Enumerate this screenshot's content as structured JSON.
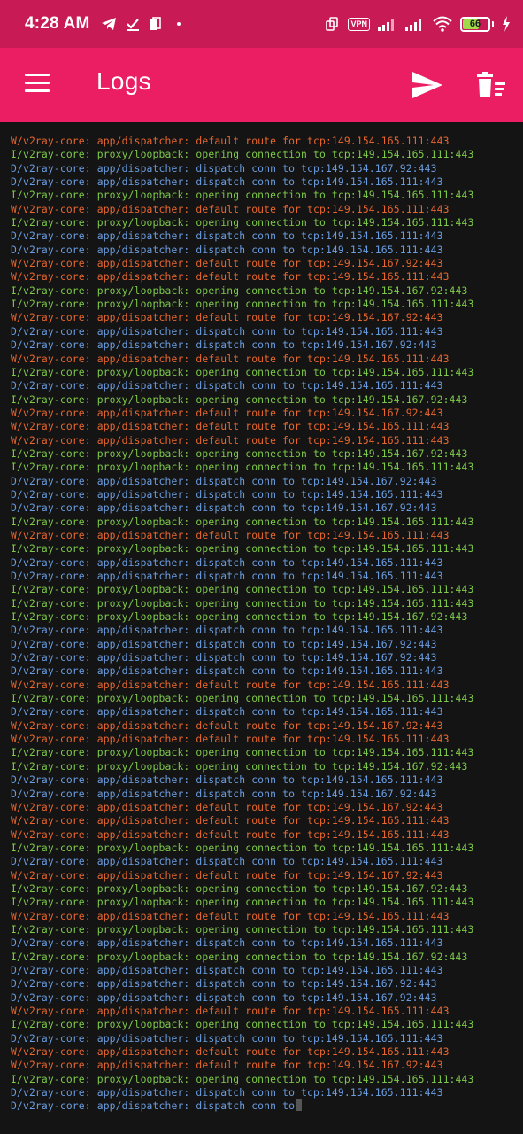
{
  "status_bar": {
    "time": "4:28 AM",
    "vpn_label": "VPN",
    "battery_level": "66",
    "icons": [
      "telegram-icon",
      "task-check-icon",
      "sim-card-icon",
      "dot-icon",
      "screen-rotate-icon",
      "vpn-icon",
      "signal-icon",
      "signal-icon",
      "wifi-icon",
      "battery-icon",
      "charging-icon"
    ]
  },
  "app_bar": {
    "title": "Logs",
    "color": "#eb1e64",
    "status_color": "#c81a55",
    "actions": [
      "menu-icon",
      "send-icon",
      "clear-all-icon"
    ]
  },
  "colors": {
    "W": "#e8672f",
    "I": "#7ec94a",
    "D": "#6a9de0",
    "background": "#141414"
  },
  "logs": [
    {
      "level": "W",
      "text": "W/v2ray-core: app/dispatcher: default route for tcp:149.154.165.111:443"
    },
    {
      "level": "I",
      "text": "I/v2ray-core: proxy/loopback: opening connection to tcp:149.154.165.111:443"
    },
    {
      "level": "D",
      "text": "D/v2ray-core: app/dispatcher: dispatch conn to tcp:149.154.167.92:443"
    },
    {
      "level": "D",
      "text": "D/v2ray-core: app/dispatcher: dispatch conn to tcp:149.154.165.111:443"
    },
    {
      "level": "I",
      "text": "I/v2ray-core: proxy/loopback: opening connection to tcp:149.154.165.111:443"
    },
    {
      "level": "W",
      "text": "W/v2ray-core: app/dispatcher: default route for tcp:149.154.165.111:443"
    },
    {
      "level": "I",
      "text": "I/v2ray-core: proxy/loopback: opening connection to tcp:149.154.165.111:443"
    },
    {
      "level": "D",
      "text": "D/v2ray-core: app/dispatcher: dispatch conn to tcp:149.154.165.111:443"
    },
    {
      "level": "D",
      "text": "D/v2ray-core: app/dispatcher: dispatch conn to tcp:149.154.165.111:443"
    },
    {
      "level": "W",
      "text": "W/v2ray-core: app/dispatcher: default route for tcp:149.154.167.92:443"
    },
    {
      "level": "W",
      "text": "W/v2ray-core: app/dispatcher: default route for tcp:149.154.165.111:443"
    },
    {
      "level": "I",
      "text": "I/v2ray-core: proxy/loopback: opening connection to tcp:149.154.167.92:443"
    },
    {
      "level": "I",
      "text": "I/v2ray-core: proxy/loopback: opening connection to tcp:149.154.165.111:443"
    },
    {
      "level": "W",
      "text": "W/v2ray-core: app/dispatcher: default route for tcp:149.154.167.92:443"
    },
    {
      "level": "D",
      "text": "D/v2ray-core: app/dispatcher: dispatch conn to tcp:149.154.165.111:443"
    },
    {
      "level": "D",
      "text": "D/v2ray-core: app/dispatcher: dispatch conn to tcp:149.154.167.92:443"
    },
    {
      "level": "W",
      "text": "W/v2ray-core: app/dispatcher: default route for tcp:149.154.165.111:443"
    },
    {
      "level": "I",
      "text": "I/v2ray-core: proxy/loopback: opening connection to tcp:149.154.165.111:443"
    },
    {
      "level": "D",
      "text": "D/v2ray-core: app/dispatcher: dispatch conn to tcp:149.154.165.111:443"
    },
    {
      "level": "I",
      "text": "I/v2ray-core: proxy/loopback: opening connection to tcp:149.154.167.92:443"
    },
    {
      "level": "W",
      "text": "W/v2ray-core: app/dispatcher: default route for tcp:149.154.167.92:443"
    },
    {
      "level": "W",
      "text": "W/v2ray-core: app/dispatcher: default route for tcp:149.154.165.111:443"
    },
    {
      "level": "W",
      "text": "W/v2ray-core: app/dispatcher: default route for tcp:149.154.165.111:443"
    },
    {
      "level": "I",
      "text": "I/v2ray-core: proxy/loopback: opening connection to tcp:149.154.167.92:443"
    },
    {
      "level": "I",
      "text": "I/v2ray-core: proxy/loopback: opening connection to tcp:149.154.165.111:443"
    },
    {
      "level": "D",
      "text": "D/v2ray-core: app/dispatcher: dispatch conn to tcp:149.154.167.92:443"
    },
    {
      "level": "D",
      "text": "D/v2ray-core: app/dispatcher: dispatch conn to tcp:149.154.165.111:443"
    },
    {
      "level": "D",
      "text": "D/v2ray-core: app/dispatcher: dispatch conn to tcp:149.154.167.92:443"
    },
    {
      "level": "I",
      "text": "I/v2ray-core: proxy/loopback: opening connection to tcp:149.154.165.111:443"
    },
    {
      "level": "W",
      "text": "W/v2ray-core: app/dispatcher: default route for tcp:149.154.165.111:443"
    },
    {
      "level": "I",
      "text": "I/v2ray-core: proxy/loopback: opening connection to tcp:149.154.165.111:443"
    },
    {
      "level": "D",
      "text": "D/v2ray-core: app/dispatcher: dispatch conn to tcp:149.154.165.111:443"
    },
    {
      "level": "D",
      "text": "D/v2ray-core: app/dispatcher: dispatch conn to tcp:149.154.165.111:443"
    },
    {
      "level": "I",
      "text": "I/v2ray-core: proxy/loopback: opening connection to tcp:149.154.165.111:443"
    },
    {
      "level": "I",
      "text": "I/v2ray-core: proxy/loopback: opening connection to tcp:149.154.165.111:443"
    },
    {
      "level": "I",
      "text": "I/v2ray-core: proxy/loopback: opening connection to tcp:149.154.167.92:443"
    },
    {
      "level": "D",
      "text": "D/v2ray-core: app/dispatcher: dispatch conn to tcp:149.154.165.111:443"
    },
    {
      "level": "D",
      "text": "D/v2ray-core: app/dispatcher: dispatch conn to tcp:149.154.167.92:443"
    },
    {
      "level": "D",
      "text": "D/v2ray-core: app/dispatcher: dispatch conn to tcp:149.154.167.92:443"
    },
    {
      "level": "D",
      "text": "D/v2ray-core: app/dispatcher: dispatch conn to tcp:149.154.165.111:443"
    },
    {
      "level": "W",
      "text": "W/v2ray-core: app/dispatcher: default route for tcp:149.154.165.111:443"
    },
    {
      "level": "I",
      "text": "I/v2ray-core: proxy/loopback: opening connection to tcp:149.154.165.111:443"
    },
    {
      "level": "D",
      "text": "D/v2ray-core: app/dispatcher: dispatch conn to tcp:149.154.165.111:443"
    },
    {
      "level": "W",
      "text": "W/v2ray-core: app/dispatcher: default route for tcp:149.154.167.92:443"
    },
    {
      "level": "W",
      "text": "W/v2ray-core: app/dispatcher: default route for tcp:149.154.165.111:443"
    },
    {
      "level": "I",
      "text": "I/v2ray-core: proxy/loopback: opening connection to tcp:149.154.165.111:443"
    },
    {
      "level": "I",
      "text": "I/v2ray-core: proxy/loopback: opening connection to tcp:149.154.167.92:443"
    },
    {
      "level": "D",
      "text": "D/v2ray-core: app/dispatcher: dispatch conn to tcp:149.154.165.111:443"
    },
    {
      "level": "D",
      "text": "D/v2ray-core: app/dispatcher: dispatch conn to tcp:149.154.167.92:443"
    },
    {
      "level": "W",
      "text": "W/v2ray-core: app/dispatcher: default route for tcp:149.154.167.92:443"
    },
    {
      "level": "W",
      "text": "W/v2ray-core: app/dispatcher: default route for tcp:149.154.165.111:443"
    },
    {
      "level": "W",
      "text": "W/v2ray-core: app/dispatcher: default route for tcp:149.154.165.111:443"
    },
    {
      "level": "I",
      "text": "I/v2ray-core: proxy/loopback: opening connection to tcp:149.154.165.111:443"
    },
    {
      "level": "D",
      "text": "D/v2ray-core: app/dispatcher: dispatch conn to tcp:149.154.165.111:443"
    },
    {
      "level": "W",
      "text": "W/v2ray-core: app/dispatcher: default route for tcp:149.154.167.92:443"
    },
    {
      "level": "I",
      "text": "I/v2ray-core: proxy/loopback: opening connection to tcp:149.154.167.92:443"
    },
    {
      "level": "I",
      "text": "I/v2ray-core: proxy/loopback: opening connection to tcp:149.154.165.111:443"
    },
    {
      "level": "W",
      "text": "W/v2ray-core: app/dispatcher: default route for tcp:149.154.165.111:443"
    },
    {
      "level": "I",
      "text": "I/v2ray-core: proxy/loopback: opening connection to tcp:149.154.165.111:443"
    },
    {
      "level": "D",
      "text": "D/v2ray-core: app/dispatcher: dispatch conn to tcp:149.154.165.111:443"
    },
    {
      "level": "I",
      "text": "I/v2ray-core: proxy/loopback: opening connection to tcp:149.154.167.92:443"
    },
    {
      "level": "D",
      "text": "D/v2ray-core: app/dispatcher: dispatch conn to tcp:149.154.165.111:443"
    },
    {
      "level": "D",
      "text": "D/v2ray-core: app/dispatcher: dispatch conn to tcp:149.154.167.92:443"
    },
    {
      "level": "D",
      "text": "D/v2ray-core: app/dispatcher: dispatch conn to tcp:149.154.167.92:443"
    },
    {
      "level": "W",
      "text": "W/v2ray-core: app/dispatcher: default route for tcp:149.154.165.111:443"
    },
    {
      "level": "I",
      "text": "I/v2ray-core: proxy/loopback: opening connection to tcp:149.154.165.111:443"
    },
    {
      "level": "D",
      "text": "D/v2ray-core: app/dispatcher: dispatch conn to tcp:149.154.165.111:443"
    },
    {
      "level": "W",
      "text": "W/v2ray-core: app/dispatcher: default route for tcp:149.154.165.111:443"
    },
    {
      "level": "W",
      "text": "W/v2ray-core: app/dispatcher: default route for tcp:149.154.167.92:443"
    },
    {
      "level": "I",
      "text": "I/v2ray-core: proxy/loopback: opening connection to tcp:149.154.165.111:443"
    },
    {
      "level": "D",
      "text": "D/v2ray-core: app/dispatcher: dispatch conn to tcp:149.154.165.111:443"
    },
    {
      "level": "D",
      "text": "D/v2ray-core: app/dispatcher: dispatch conn to",
      "cursor": true
    }
  ]
}
